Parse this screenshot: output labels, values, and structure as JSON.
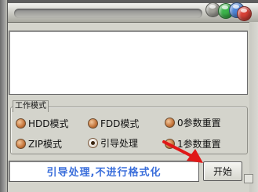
{
  "window": {
    "controls": [
      "minimize-orb",
      "maximize-orb",
      "close-orb"
    ]
  },
  "mode_group": {
    "legend": "工作模式",
    "options": [
      {
        "label": "HDD模式",
        "checked": false
      },
      {
        "label": "FDD模式",
        "checked": false
      },
      {
        "label": "0参数重置",
        "checked": false
      },
      {
        "label": "ZIP模式",
        "checked": false
      },
      {
        "label": "引导处理",
        "checked": true
      },
      {
        "label": "1参数重置",
        "checked": false
      }
    ]
  },
  "status": {
    "text": "引导处理,不进行格式化"
  },
  "start_button": {
    "label": "开始"
  },
  "colors": {
    "status_text": "#3a6edb",
    "annotation_arrow": "#e01818",
    "radio_orange": "#c3743a"
  }
}
